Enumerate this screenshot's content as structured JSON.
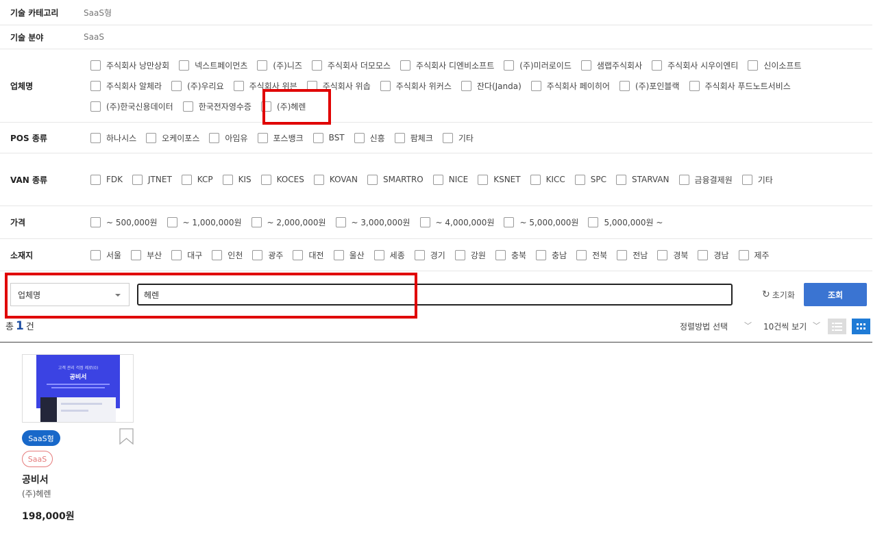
{
  "tech_category": {
    "label": "기술 카테고리",
    "value": "SaaS형"
  },
  "tech_field": {
    "label": "기술 분야",
    "value": "SaaS"
  },
  "company": {
    "label": "업체명",
    "options": [
      "주식회사 낭만상회",
      "넥스트페이먼츠",
      "(주)니즈",
      "주식회사 더모모스",
      "주식회사 디엔비소프트",
      "(주)미러로이드",
      "샘랩주식회사",
      "주식회사 시우이엔티",
      "신이소프트",
      "주식회사 알체라",
      "(주)우리요",
      "주식회사 위븐",
      "주식회사 위솝",
      "주식회사 위커스",
      "잔다(Janda)",
      "주식회사 페이히어",
      "(주)포인블랙",
      "주식회사 푸드노트서비스",
      "(주)한국신용데이터",
      "한국전자영수증",
      "(주)헤렌"
    ]
  },
  "pos": {
    "label": "POS 종류",
    "options": [
      "하나시스",
      "오케이포스",
      "아임유",
      "포스뱅크",
      "BST",
      "신흥",
      "팜체크",
      "기타"
    ]
  },
  "van": {
    "label": "VAN 종류",
    "options": [
      "FDK",
      "JTNET",
      "KCP",
      "KIS",
      "KOCES",
      "KOVAN",
      "SMARTRO",
      "NICE",
      "KSNET",
      "KICC",
      "SPC",
      "STARVAN",
      "금융결제원",
      "기타"
    ]
  },
  "price": {
    "label": "가격",
    "options": [
      "~ 500,000원",
      "~ 1,000,000원",
      "~ 2,000,000원",
      "~ 3,000,000원",
      "~ 4,000,000원",
      "~ 5,000,000원",
      "5,000,000원 ~"
    ]
  },
  "location": {
    "label": "소재지",
    "options": [
      "서울",
      "부산",
      "대구",
      "인천",
      "광주",
      "대전",
      "울산",
      "세종",
      "경기",
      "강원",
      "충북",
      "충남",
      "전북",
      "전남",
      "경북",
      "경남",
      "제주"
    ]
  },
  "search": {
    "select_value": "업체명",
    "query": "헤렌",
    "reset_label": "초기화",
    "submit_label": "조회"
  },
  "results": {
    "total_prefix": "총",
    "total_count": "1",
    "total_suffix": "건",
    "sort_label": "정렬방법 선택",
    "per_page_label": "10건씩 보기"
  },
  "product": {
    "type_badge": "SaaS형",
    "field_badge": "SaaS",
    "name": "공비서",
    "company": "(주)헤렌",
    "price": "198,000원",
    "thumb_small": "고객 관리 걱정 제로(0)",
    "thumb_title": "공비서"
  },
  "colors": {
    "accent": "#3a74d2",
    "highlight": "#e00000",
    "badge_blue": "#1868c9",
    "badge_red": "#e57a7a"
  }
}
